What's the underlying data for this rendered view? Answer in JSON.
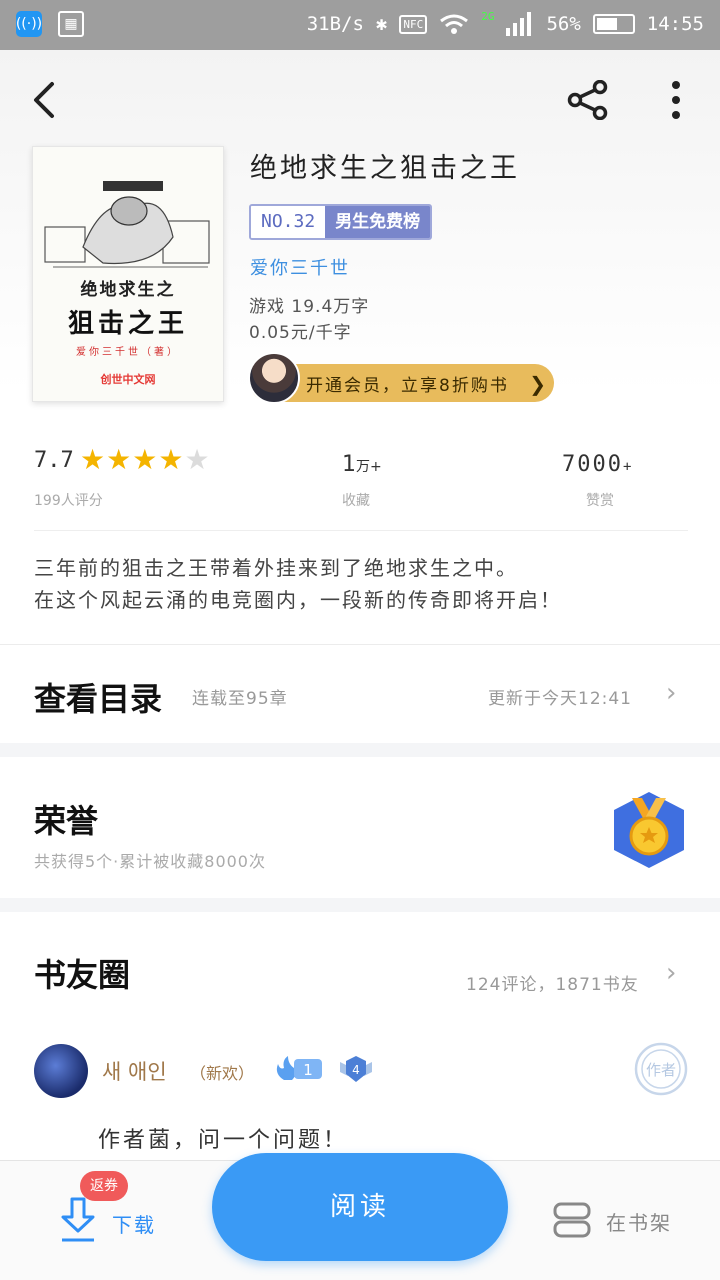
{
  "status_bar": {
    "speed": "31B/s",
    "nfc": "NFC",
    "network": "2G",
    "battery": "56%",
    "time": "14:55"
  },
  "book": {
    "cover": {
      "line1": "绝地求生之",
      "line2": "狙击之王",
      "line3": "爱你三千世（著）",
      "publisher": "创世中文网"
    },
    "title": "绝地求生之狙击之王",
    "rank_no": "NO.32",
    "rank_name": "男生免费榜",
    "author": "爱你三千世",
    "category_words": "游戏  19.4万字",
    "price": "0.05元/千字",
    "vip_promo": "开通会员，立享8折购书"
  },
  "stats": {
    "rating": "7.7",
    "rating_count": "199人评分",
    "stars": {
      "filled": 4,
      "total": 5
    },
    "favorites_value": "1",
    "favorites_unit": "万+",
    "favorites_label": "收藏",
    "likes_value": "7000",
    "likes_unit": "+",
    "likes_label": "赞赏"
  },
  "intro": {
    "line1": "三年前的狙击之王带着外挂来到了绝地求生之中。",
    "line2": "在这个风起云涌的电竞圈内，一段新的传奇即将开启！"
  },
  "toc": {
    "title": "查看目录",
    "serial": "连载至95章",
    "updated": "更新于今天12:41"
  },
  "honor": {
    "title": "荣誉",
    "summary": "共获得5个·累计被收藏8000次"
  },
  "circle": {
    "title": "书友圈",
    "stats": "124评论，1871书友",
    "comment": {
      "user": "새 애인",
      "tag": "（新欢）",
      "fan_level": "1",
      "user_level": "4",
      "stamp": "作者",
      "text": "作者菌，问一个问题！"
    }
  },
  "bottom_bar": {
    "coupon": "返券",
    "download": "下载",
    "read": "阅读",
    "shelf": "在书架"
  },
  "colors": {
    "accent": "#3a9af5",
    "author_blue": "#3d8fe0",
    "star": "#f4b400",
    "vip_gold": "#e8bb5c",
    "rank_purple": "#7986cb"
  }
}
